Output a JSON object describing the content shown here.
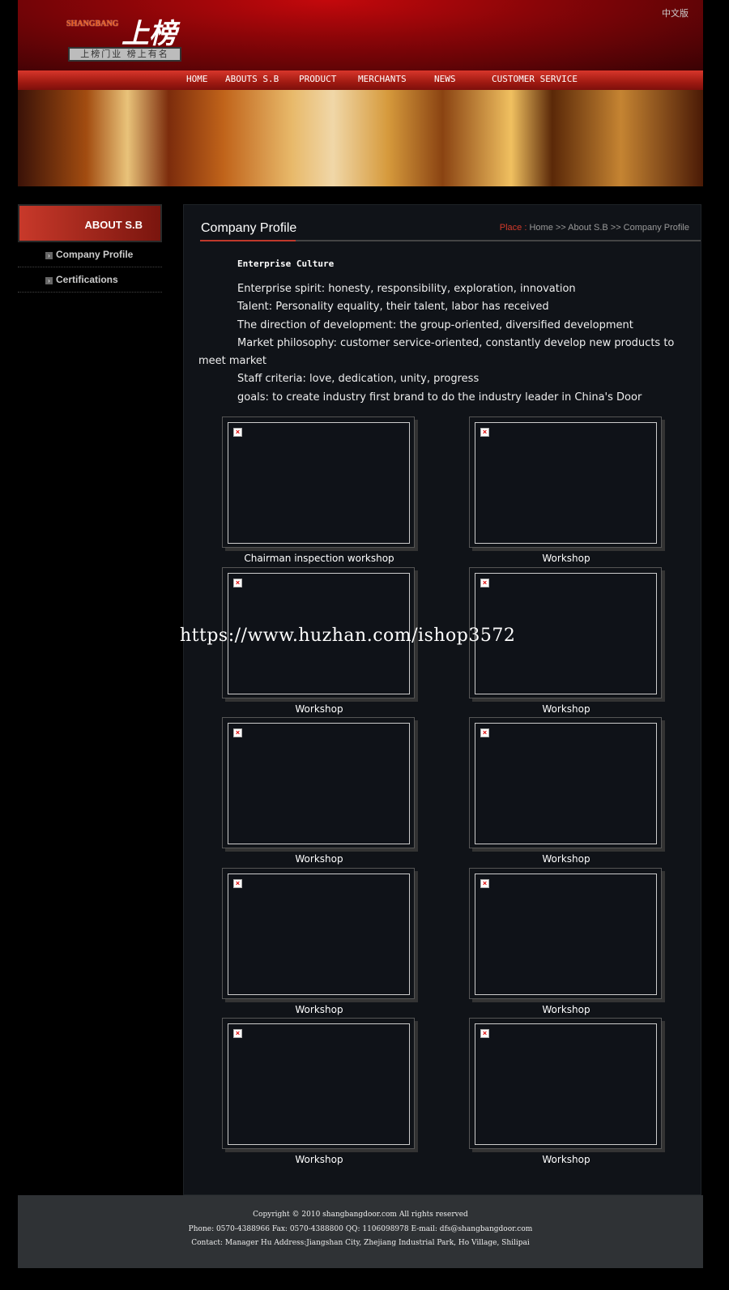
{
  "header": {
    "logo_en": "SHANGBANG",
    "logo_cn": "上榜",
    "logo_slogan": "上榜门业 榜上有名",
    "lang": "中文版"
  },
  "nav": [
    {
      "label": "HOME"
    },
    {
      "label": "ABOUTS S.B"
    },
    {
      "label": "PRODUCT"
    },
    {
      "label": "MERCHANTS"
    },
    {
      "label": "NEWS"
    },
    {
      "label": "CUSTOMER SERVICE"
    }
  ],
  "sidebar": {
    "heading": "ABOUT S.B",
    "items": [
      {
        "label": "Company Profile"
      },
      {
        "label": "Certifications"
      }
    ]
  },
  "main": {
    "title": "Company Profile",
    "breadcrumb": {
      "place": "Place :",
      "path": "Home >> About S.B >> Company Profile"
    },
    "culture_heading": "Enterprise Culture",
    "paragraphs": [
      "Enterprise spirit: honesty, responsibility, exploration, innovation",
      "Talent: Personality equality, their talent, labor has received",
      "The direction of development: the group-oriented, diversified development",
      "Market philosophy: customer service-oriented, constantly develop new products to meet market",
      "Staff criteria: love, dedication, unity, progress",
      "goals: to create industry first brand to do the industry leader in China's Door"
    ],
    "gallery": [
      {
        "caption": "Chairman inspection workshop"
      },
      {
        "caption": "Workshop"
      },
      {
        "caption": "Workshop"
      },
      {
        "caption": "Workshop"
      },
      {
        "caption": "Workshop"
      },
      {
        "caption": "Workshop"
      },
      {
        "caption": "Workshop"
      },
      {
        "caption": "Workshop"
      },
      {
        "caption": "Workshop"
      },
      {
        "caption": "Workshop"
      }
    ]
  },
  "watermark": "https://www.huzhan.com/ishop3572",
  "footer": {
    "copyright": "Copyright © 2010 shangbangdoor.com All rights reserved",
    "contact1": "Phone: 0570-4388966 Fax: 0570-4388800 QQ: 1106098978 E-mail: dfs@shangbangdoor.com",
    "contact2": "Contact: Manager Hu Address:Jiangshan City, Zhejiang Industrial Park, Ho Village, Shilipai"
  }
}
